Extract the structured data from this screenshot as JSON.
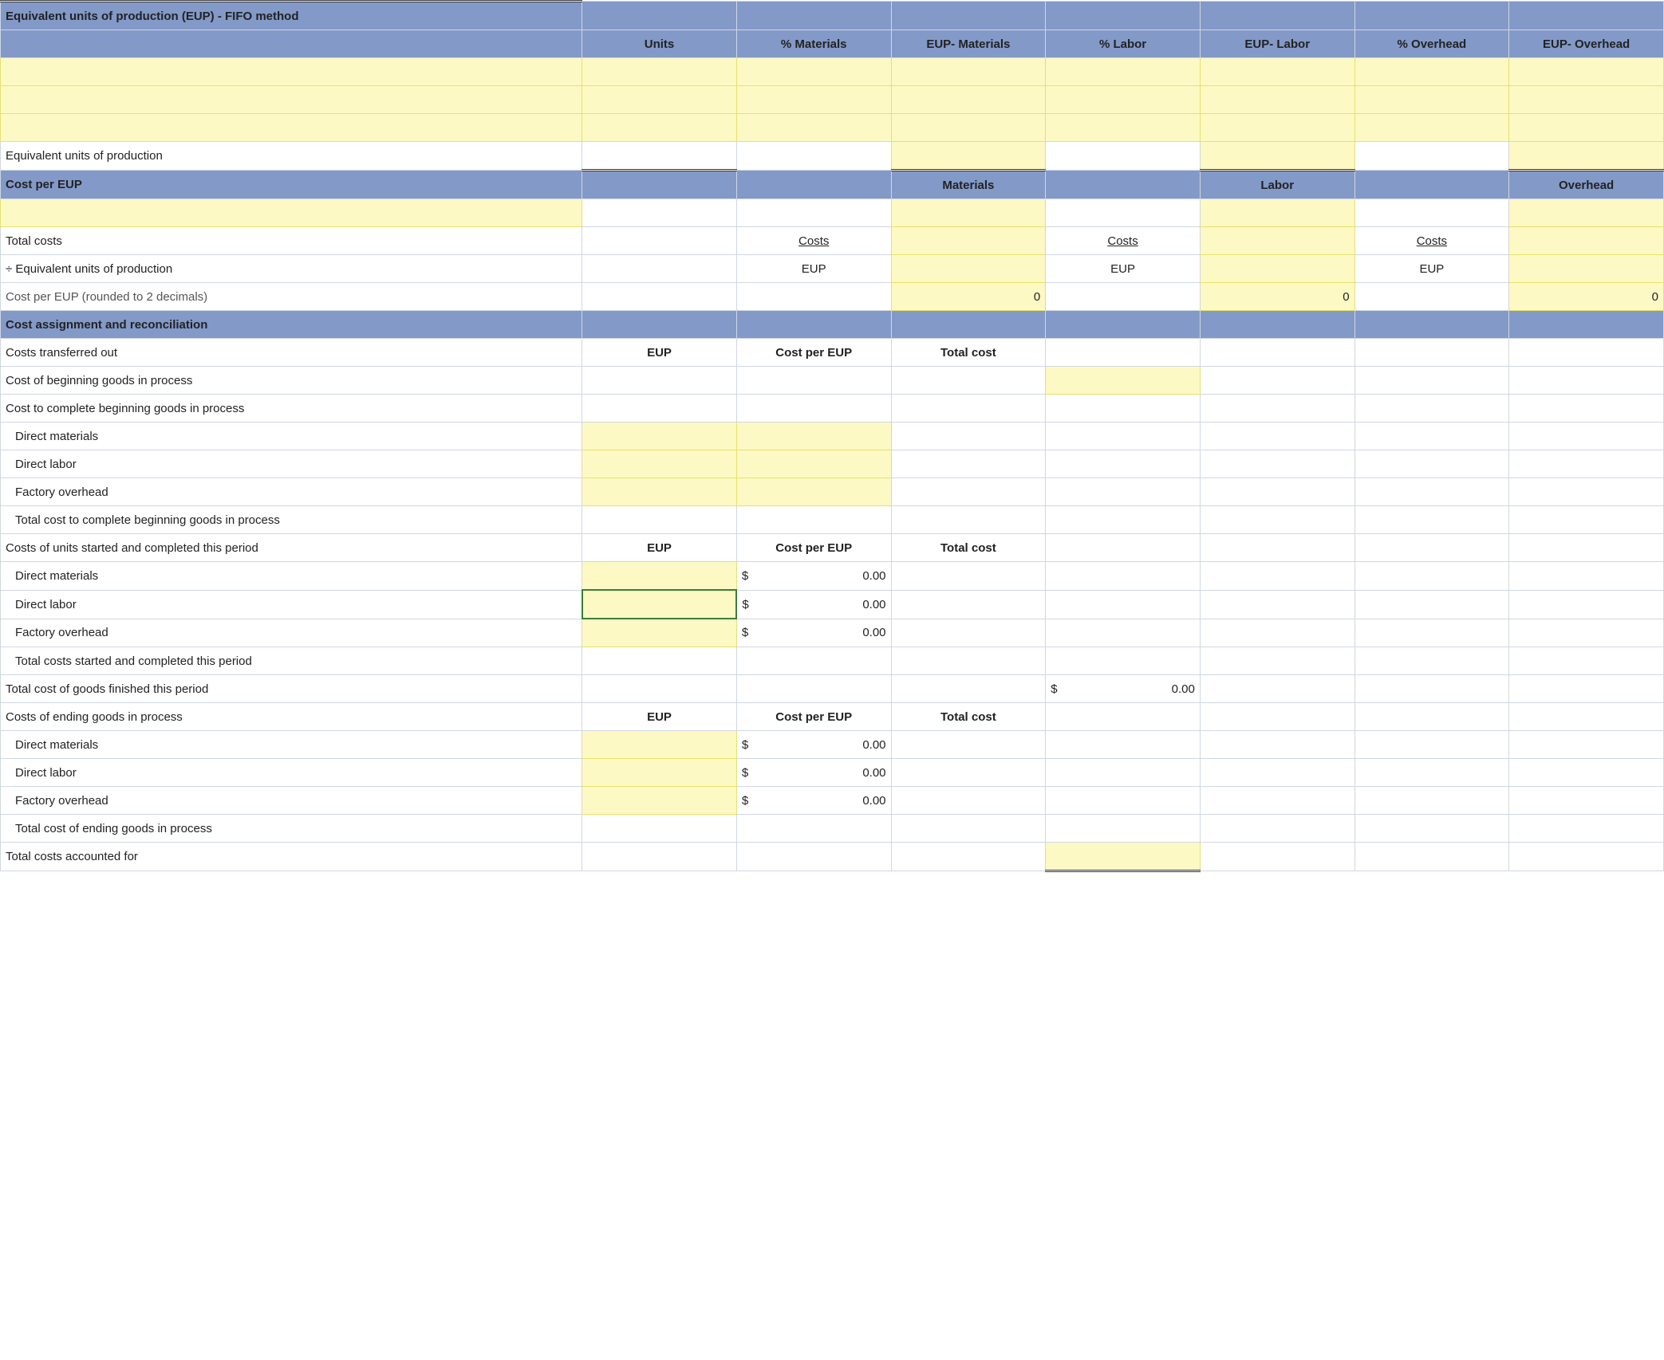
{
  "section1": {
    "title": "Equivalent units of production (EUP) - FIFO method",
    "headers": [
      "Units",
      "% Materials",
      "EUP- Materials",
      "% Labor",
      "EUP- Labor",
      "% Overhead",
      "EUP- Overhead"
    ],
    "eup_label": "Equivalent units of production"
  },
  "section2": {
    "title": "Cost per EUP",
    "col_materials": "Materials",
    "col_labor": "Labor",
    "col_overhead": "Overhead",
    "total_costs": "Total costs",
    "costs": "Costs",
    "div_eup": "÷ Equivalent units of production",
    "eup": "EUP",
    "cost_per_eup": "Cost per EUP (rounded to 2 decimals)",
    "zero": "0"
  },
  "section3": {
    "title": "Cost assignment and reconciliation",
    "transferred": "Costs transferred out",
    "eup": "EUP",
    "cpe": "Cost per EUP",
    "totcost": "Total cost",
    "beg_gip": "Cost of beginning goods in process",
    "complete_beg": "Cost to complete beginning goods in process",
    "dm": "Direct materials",
    "dl": "Direct labor",
    "foh": "Factory overhead",
    "total_complete_beg": "Total cost to complete beginning goods in process",
    "started_completed": "Costs of units started and completed this period",
    "zero_dollar": "0.00",
    "total_started_completed": "Total costs started and completed this period",
    "total_finished": "Total cost of goods finished this period",
    "ending_gip": "Costs of ending goods in process",
    "total_ending": "Total cost of ending goods in process",
    "total_accounted": "Total costs accounted for",
    "dollar": "$"
  }
}
